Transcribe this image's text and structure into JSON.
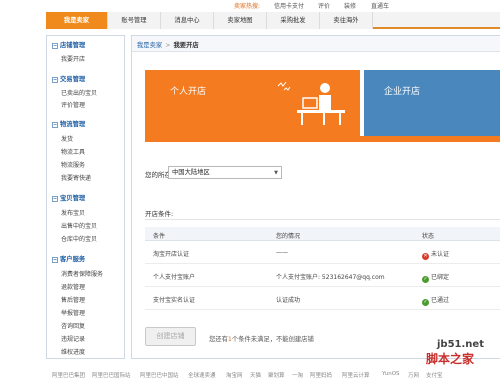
{
  "hotbar": {
    "label": "卖家热搜:",
    "links": [
      "信用卡支付",
      "评价",
      "装修",
      "直通车"
    ]
  },
  "mainnav": {
    "tabs": [
      "我是卖家",
      "账号管理",
      "消息中心",
      "卖家地图",
      "采购批发",
      "卖往海外"
    ],
    "active_index": 0,
    "accent_color": "#f08a1c"
  },
  "sidebar": {
    "sections": [
      {
        "title": "店铺管理",
        "items": [
          "我要开店"
        ]
      },
      {
        "title": "交易管理",
        "items": [
          "已卖出的宝贝",
          "评价管理"
        ]
      },
      {
        "title": "物流管理",
        "items": [
          "发货",
          "物流工具",
          "物流服务",
          "我要寄快递"
        ]
      },
      {
        "title": "宝贝管理",
        "items": [
          "发布宝贝",
          "出售中的宝贝",
          "仓库中的宝贝"
        ]
      },
      {
        "title": "客户服务",
        "items": [
          "消费者保障服务",
          "退款管理",
          "售后管理",
          "举报管理",
          "咨询回复",
          "违规记录",
          "维权进度"
        ]
      }
    ]
  },
  "breadcrumb": {
    "root": "我是卖家",
    "separator": ">",
    "current": "我要开店"
  },
  "banners": {
    "personal": {
      "label": "个人开店",
      "color": "#f47b20"
    },
    "enterprise": {
      "label": "企业开店",
      "color": "#4a87bd"
    }
  },
  "region": {
    "label": "您的所在地:",
    "selected": "中国大陆地区"
  },
  "conditions": {
    "label": "开店条件:",
    "headers": [
      "条件",
      "您的情况",
      "状态"
    ],
    "rows": [
      {
        "condition": "淘宝开店认证",
        "situation": "——",
        "status": "未认证",
        "status_type": "fail"
      },
      {
        "condition": "个人支付宝账户",
        "situation": "个人支付宝账户: 523162647@qq.com",
        "status": "已绑定",
        "status_type": "ok"
      },
      {
        "condition": "支付宝实名认证",
        "situation": "认证成功",
        "status": "已通过",
        "status_type": "ok"
      }
    ]
  },
  "create": {
    "button": "创建店铺",
    "note_before": "您还有",
    "note_count": "1",
    "note_after": "个条件未满足，不能创建店铺"
  },
  "footer": {
    "links": [
      "阿里巴巴集团",
      "阿里巴巴国际站",
      "阿里巴巴中国站",
      "全球速卖通",
      "淘宝网",
      "天猫",
      "聚划算",
      "一淘",
      "阿里妈妈",
      "阿里云计算",
      "YunOS",
      "万网",
      "支付宝"
    ]
  },
  "watermark": {
    "line1": "jb51.net",
    "line2": "脚本之家"
  }
}
